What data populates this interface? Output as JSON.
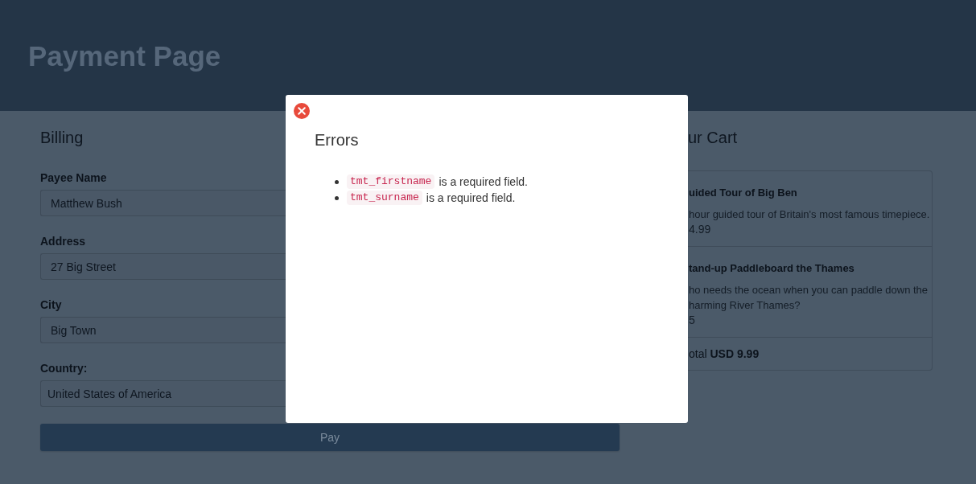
{
  "header": {
    "title": "Payment Page"
  },
  "billing": {
    "heading": "Billing",
    "fields": [
      {
        "kind": "text",
        "label": "Payee Name",
        "value": "Matthew Bush"
      },
      {
        "kind": "text",
        "label": "Address",
        "value": "27 Big Street"
      },
      {
        "kind": "text",
        "label": "City",
        "value": "Big Town"
      },
      {
        "kind": "select",
        "label": "Country:",
        "value": "United States of America"
      }
    ],
    "pay_button": "Pay"
  },
  "cart": {
    "heading": "ur Cart",
    "items": [
      {
        "title": "uided Tour of Big Ben",
        "description_lines": [
          "hour guided tour of Britain's most famous timepiece."
        ],
        "price": "4.99"
      },
      {
        "title": "tand-up Paddleboard the Thames",
        "description_lines": [
          "ho needs the ocean when you can paddle down the",
          "harming River Thames?"
        ],
        "price": "5"
      }
    ],
    "total": "otal **USD 9.99**"
  },
  "error_dialog": {
    "title": "Errors",
    "errors": [
      {
        "field": "tmt_firstname",
        "message": "is a required field."
      },
      {
        "field": "tmt_surname",
        "message": "is a required field."
      }
    ]
  }
}
